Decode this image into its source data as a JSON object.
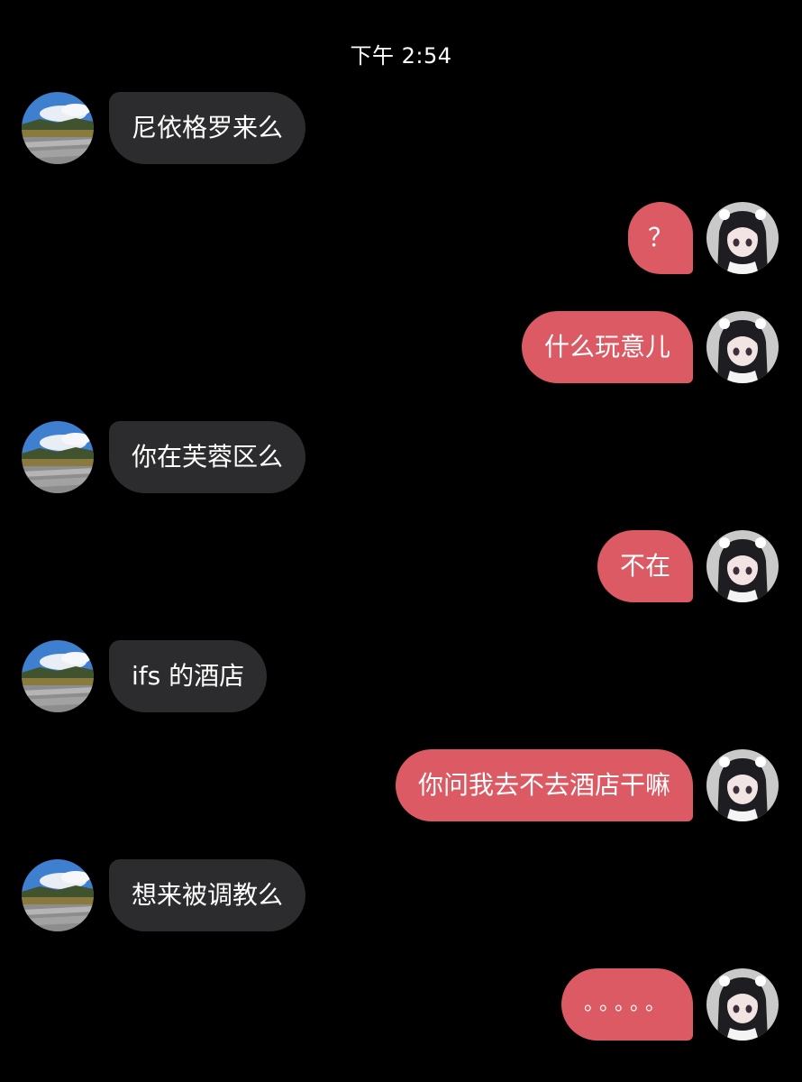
{
  "conversation": {
    "timestamp": "下午 2:54",
    "colors": {
      "background": "#000000",
      "incoming_bubble": "#2c2c2e",
      "outgoing_bubble": "#dc5a63",
      "text": "#ffffff"
    },
    "messages": [
      {
        "sender": "other",
        "text": "尼依格罗来么",
        "avatar": "landscape-avatar"
      },
      {
        "sender": "me",
        "text": "？",
        "avatar": "anime-girl-avatar"
      },
      {
        "sender": "me",
        "text": "什么玩意儿",
        "avatar": "anime-girl-avatar"
      },
      {
        "sender": "other",
        "text": "你在芙蓉区么",
        "avatar": "landscape-avatar"
      },
      {
        "sender": "me",
        "text": "不在",
        "avatar": "anime-girl-avatar"
      },
      {
        "sender": "other",
        "text": "ifs 的酒店",
        "avatar": "landscape-avatar"
      },
      {
        "sender": "me",
        "text": "你问我去不去酒店干嘛",
        "avatar": "anime-girl-avatar"
      },
      {
        "sender": "other",
        "text": "想来被调教么",
        "avatar": "landscape-avatar"
      },
      {
        "sender": "me",
        "text": "。。。。。",
        "avatar": "anime-girl-avatar"
      }
    ]
  }
}
